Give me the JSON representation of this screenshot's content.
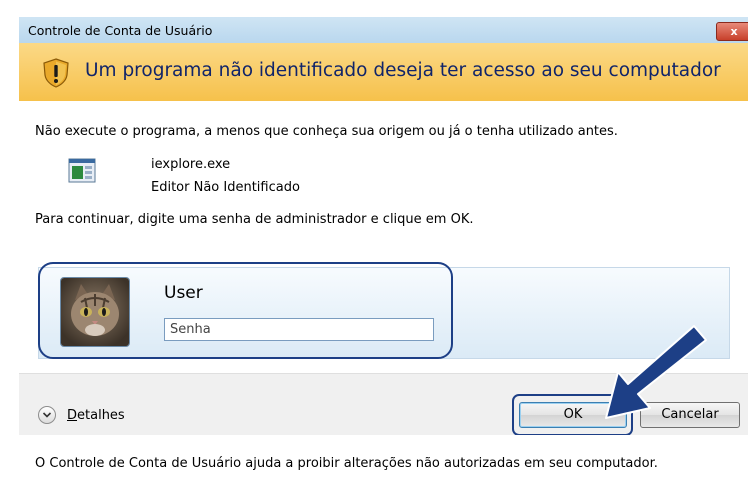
{
  "window": {
    "title": "Controle de Conta de Usuário",
    "close_glyph": "x"
  },
  "warning": {
    "headline": "Um programa não identificado deseja ter acesso ao seu computador",
    "icon": "uac-shield-warning-icon"
  },
  "body": {
    "instruction": "Não execute o programa, a menos que conheça sua origem ou já o tenha utilizado antes.",
    "program_name": "iexplore.exe",
    "publisher": "Editor Não Identificado",
    "prompt": "Para continuar, digite uma senha de administrador e clique em OK."
  },
  "credentials": {
    "user_name": "User",
    "password_placeholder": "Senha",
    "avatar": "cat-avatar"
  },
  "details": {
    "label_first": "D",
    "label_rest": "etalhes",
    "icon": "chevron-down-icon"
  },
  "buttons": {
    "ok": "OK",
    "cancel": "Cancelar"
  },
  "footer": {
    "text": "O Controle de Conta de Usuário ajuda a proibir alterações não autorizadas em seu computador."
  },
  "colors": {
    "warning_bar": "#f6c14b",
    "headline": "#10246a",
    "highlight": "#1d3f86",
    "arrow": "#1d3f86"
  }
}
